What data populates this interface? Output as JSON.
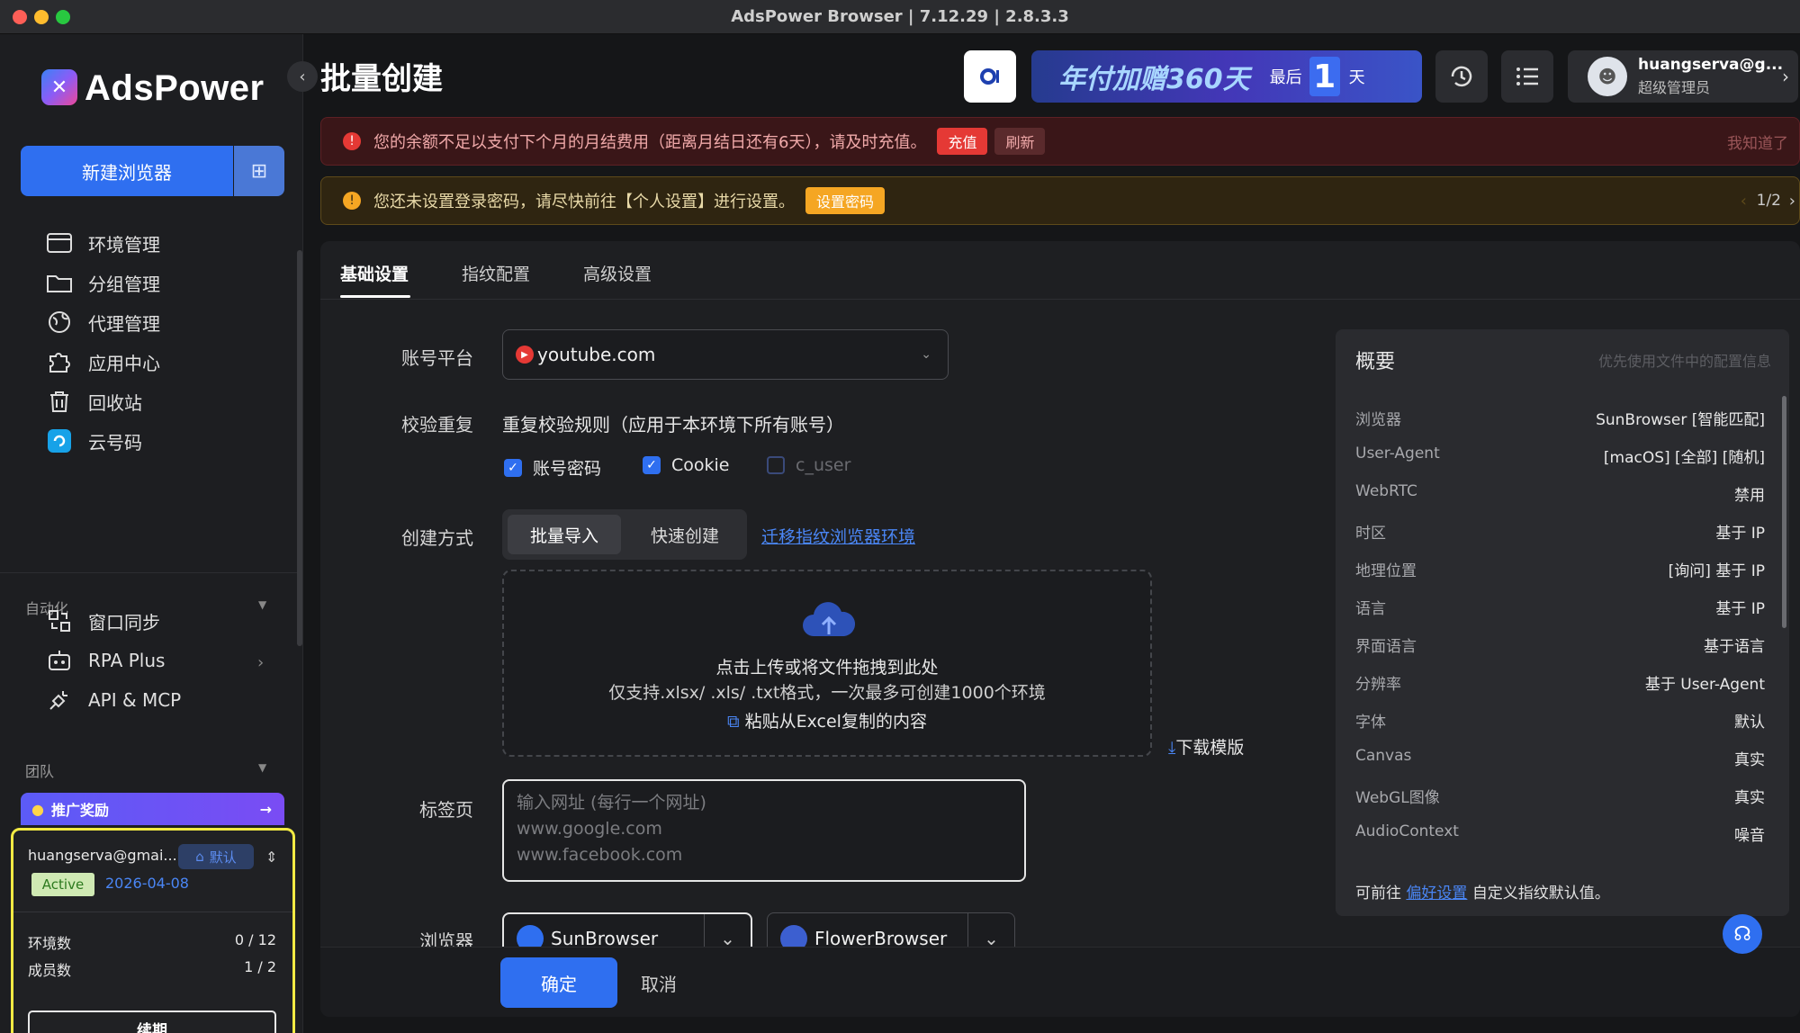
{
  "window": {
    "title": "AdsPower Browser | 7.12.29 | 2.8.3.3"
  },
  "brand": {
    "name": "AdsPower"
  },
  "sidebar": {
    "new_browser": "新建浏览器",
    "items": [
      {
        "label": "环境管理",
        "icon": "window-icon"
      },
      {
        "label": "分组管理",
        "icon": "folder-icon"
      },
      {
        "label": "代理管理",
        "icon": "globe-icon"
      },
      {
        "label": "应用中心",
        "icon": "puzzle-icon"
      },
      {
        "label": "回收站",
        "icon": "trash-icon"
      },
      {
        "label": "云号码",
        "icon": "cloud-number-icon"
      }
    ],
    "section_automation": "自动化",
    "automation_items": [
      {
        "label": "窗口同步",
        "icon": "sync-icon"
      },
      {
        "label": "RPA Plus",
        "icon": "robot-icon"
      },
      {
        "label": "API & MCP",
        "icon": "plug-icon"
      }
    ],
    "section_team": "团队",
    "promo": "推广奖励",
    "account": {
      "email": "huangserva@gmai...",
      "default_badge": "默认",
      "status": "Active",
      "expiry": "2026-04-08",
      "env_label": "环境数",
      "env_value": "0 / 12",
      "member_label": "成员数",
      "member_value": "1 / 2",
      "renew": "续期"
    }
  },
  "header": {
    "page_title": "批量创建",
    "promo_text": "年付加赠360天",
    "promo_last": "最后",
    "promo_days": "1",
    "promo_unit": "天",
    "user_name": "huangserva@g...",
    "user_role": "超级管理员"
  },
  "alerts": {
    "red": {
      "text": "您的余额不足以支付下个月的月结费用（距离月结日还有6天），请及时充值。",
      "recharge": "充值",
      "refresh": "刷新",
      "dismiss": "我知道了"
    },
    "yellow": {
      "text": "您还未设置登录密码，请尽快前往【个人设置】进行设置。",
      "action": "设置密码",
      "pager": "1/2"
    }
  },
  "tabs": [
    "基础设置",
    "指纹配置",
    "高级设置"
  ],
  "form": {
    "platform_label": "账号平台",
    "platform_value": "youtube.com",
    "dup_label": "校验重复",
    "dup_rule": "重复校验规则（应用于本环境下所有账号）",
    "checks": [
      {
        "label": "账号密码",
        "checked": true
      },
      {
        "label": "Cookie",
        "checked": true
      },
      {
        "label": "c_user",
        "checked": false
      }
    ],
    "create_label": "创建方式",
    "create_batch": "批量导入",
    "create_quick": "快速创建",
    "migrate_link": "迁移指纹浏览器环境",
    "upload_title": "点击上传或将文件拖拽到此处",
    "upload_hint": "仅支持.xlsx/ .xls/ .txt格式，一次最多可创建1000个环境",
    "paste_excel": "粘贴从Excel复制的内容",
    "download_template": "下载模版",
    "tabs_label": "标签页",
    "tabs_placeholder_1": "输入网址 (每行一个网址)",
    "tabs_placeholder_2": "www.google.com",
    "tabs_placeholder_3": "www.facebook.com",
    "browser_label": "浏览器",
    "browser_sun": "SunBrowser",
    "browser_flower": "FlowerBrowser"
  },
  "overview": {
    "title": "概要",
    "hint": "优先使用文件中的配置信息",
    "rows": [
      {
        "k": "浏览器",
        "v": "SunBrowser [智能匹配]"
      },
      {
        "k": "User-Agent",
        "v": "[macOS] [全部] [随机]"
      },
      {
        "k": "WebRTC",
        "v": "禁用"
      },
      {
        "k": "时区",
        "v": "基于 IP"
      },
      {
        "k": "地理位置",
        "v": "[询问] 基于 IP"
      },
      {
        "k": "语言",
        "v": "基于 IP"
      },
      {
        "k": "界面语言",
        "v": "基于语言"
      },
      {
        "k": "分辨率",
        "v": "基于 User-Agent"
      },
      {
        "k": "字体",
        "v": "默认"
      },
      {
        "k": "Canvas",
        "v": "真实"
      },
      {
        "k": "WebGL图像",
        "v": "真实"
      },
      {
        "k": "AudioContext",
        "v": "噪音"
      }
    ],
    "footer_pre": "可前往",
    "footer_link": "偏好设置",
    "footer_post": "自定义指纹默认值。"
  },
  "actions": {
    "ok": "确定",
    "cancel": "取消"
  },
  "colors": {
    "accent": "#2f6ff0",
    "danger": "#e53935",
    "warning": "#f5a623"
  }
}
